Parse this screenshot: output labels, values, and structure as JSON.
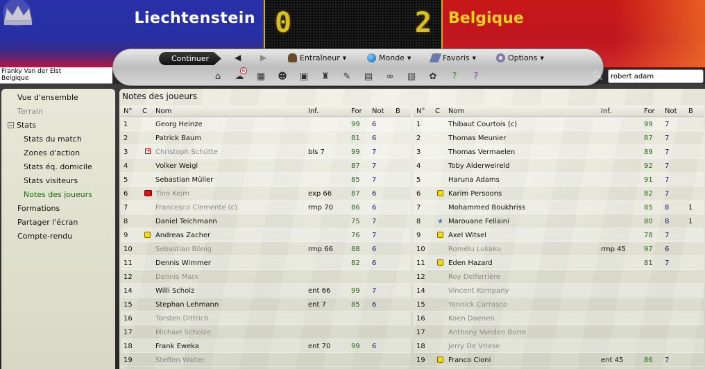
{
  "match": {
    "home_team": "Liechtenstein",
    "away_team": "Belgique",
    "home_score": "0",
    "away_score": "2"
  },
  "toolbar": {
    "continue_label": "Continuer",
    "menus": [
      "Entraîneur",
      "Monde",
      "Favoris",
      "Options"
    ],
    "notifications_badge": "6",
    "icons": [
      "home-icon",
      "inbox-icon",
      "calendar-icon",
      "squad-icon",
      "tactics-icon",
      "trophy-icon",
      "scout-icon",
      "clipboard-icon",
      "binoculars-icon",
      "report-icon",
      "club-icon",
      "help-icon",
      "question-icon"
    ]
  },
  "manager": {
    "name": "Franky Van der Elst",
    "team": "Belgique"
  },
  "search": {
    "value": "robert adam"
  },
  "sidebar": {
    "items": [
      {
        "label": "Vue d'ensemble",
        "state": "normal"
      },
      {
        "label": "Terrain",
        "state": "dim"
      },
      {
        "label": "Stats",
        "state": "group"
      },
      {
        "label": "Stats du match",
        "state": "normal"
      },
      {
        "label": "Zones d'action",
        "state": "normal"
      },
      {
        "label": "Stats éq. domicile",
        "state": "normal"
      },
      {
        "label": "Stats visiteurs",
        "state": "normal"
      },
      {
        "label": "Notes des joueurs",
        "state": "active"
      },
      {
        "label": "Formations",
        "state": "normal"
      },
      {
        "label": "Partager l'écran",
        "state": "normal"
      },
      {
        "label": "Compte-rendu",
        "state": "normal"
      }
    ]
  },
  "panel": {
    "title": "Notes des joueurs",
    "columns": {
      "num": "N°",
      "c": "C",
      "nom": "Nom",
      "inf": "Inf.",
      "for": "For",
      "not": "Not",
      "b": "B"
    }
  },
  "home_players": [
    {
      "n": "1",
      "name": "Georg Heinze",
      "inf": "",
      "for": "99",
      "not": "6",
      "b": "",
      "mark": "",
      "dim": false
    },
    {
      "n": "2",
      "name": "Patrick Baum",
      "inf": "",
      "for": "81",
      "not": "6",
      "b": "",
      "mark": "",
      "dim": false
    },
    {
      "n": "3",
      "name": "Christoph Schütte",
      "inf": "bls 7",
      "for": "99",
      "not": "7",
      "b": "",
      "mark": "injury",
      "dim": true
    },
    {
      "n": "4",
      "name": "Volker Weigl",
      "inf": "",
      "for": "87",
      "not": "7",
      "b": "",
      "mark": "",
      "dim": false
    },
    {
      "n": "5",
      "name": "Sebastian Müller",
      "inf": "",
      "for": "85",
      "not": "7",
      "b": "",
      "mark": "",
      "dim": false
    },
    {
      "n": "6",
      "name": "Tino Keim",
      "inf": "exp 66",
      "for": "87",
      "not": "6",
      "b": "",
      "mark": "red",
      "dim": true
    },
    {
      "n": "7",
      "name": "Francesco Clemente (c)",
      "inf": "rmp 70",
      "for": "86",
      "not": "6",
      "b": "",
      "mark": "",
      "dim": true
    },
    {
      "n": "8",
      "name": "Daniel Teichmann",
      "inf": "",
      "for": "75",
      "not": "7",
      "b": "",
      "mark": "",
      "dim": false
    },
    {
      "n": "9",
      "name": "Andreas Zacher",
      "inf": "",
      "for": "76",
      "not": "7",
      "b": "",
      "mark": "yellow",
      "dim": false
    },
    {
      "n": "10",
      "name": "Sebastian Bönig",
      "inf": "rmp 66",
      "for": "88",
      "not": "6",
      "b": "",
      "mark": "",
      "dim": true
    },
    {
      "n": "11",
      "name": "Dennis Wimmer",
      "inf": "",
      "for": "82",
      "not": "6",
      "b": "",
      "mark": "",
      "dim": false
    },
    {
      "n": "12",
      "name": "Dennis Marx",
      "inf": "",
      "for": "",
      "not": "",
      "b": "",
      "mark": "",
      "dim": true
    },
    {
      "n": "14",
      "name": "Willi Scholz",
      "inf": "ent 66",
      "for": "99",
      "not": "7",
      "b": "",
      "mark": "",
      "dim": false
    },
    {
      "n": "15",
      "name": "Stephan Lehmann",
      "inf": "ent 7",
      "for": "85",
      "not": "6",
      "b": "",
      "mark": "",
      "dim": false
    },
    {
      "n": "16",
      "name": "Torsten Dittrich",
      "inf": "",
      "for": "",
      "not": "",
      "b": "",
      "mark": "",
      "dim": true
    },
    {
      "n": "17",
      "name": "Michael Scholze",
      "inf": "",
      "for": "",
      "not": "",
      "b": "",
      "mark": "",
      "dim": true
    },
    {
      "n": "18",
      "name": "Frank Eweka",
      "inf": "ent 70",
      "for": "99",
      "not": "6",
      "b": "",
      "mark": "",
      "dim": false
    },
    {
      "n": "19",
      "name": "Steffen Walter",
      "inf": "",
      "for": "",
      "not": "",
      "b": "",
      "mark": "",
      "dim": true
    }
  ],
  "away_players": [
    {
      "n": "1",
      "name": "Thibaut Courtois (c)",
      "inf": "",
      "for": "99",
      "not": "7",
      "b": "",
      "mark": "",
      "dim": false
    },
    {
      "n": "2",
      "name": "Thomas Meunier",
      "inf": "",
      "for": "87",
      "not": "7",
      "b": "",
      "mark": "",
      "dim": false
    },
    {
      "n": "3",
      "name": "Thomas Vermaelen",
      "inf": "",
      "for": "89",
      "not": "7",
      "b": "",
      "mark": "",
      "dim": false
    },
    {
      "n": "4",
      "name": "Toby Alderweireld",
      "inf": "",
      "for": "92",
      "not": "7",
      "b": "",
      "mark": "",
      "dim": false
    },
    {
      "n": "5",
      "name": "Haruna Adams",
      "inf": "",
      "for": "91",
      "not": "7",
      "b": "",
      "mark": "",
      "dim": false
    },
    {
      "n": "6",
      "name": "Karim Persoons",
      "inf": "",
      "for": "82",
      "not": "7",
      "b": "",
      "mark": "yellow",
      "dim": false
    },
    {
      "n": "7",
      "name": "Mohammed Boukhriss",
      "inf": "",
      "for": "85",
      "not": "8",
      "b": "1",
      "mark": "",
      "dim": false
    },
    {
      "n": "8",
      "name": "Marouane Fellaini",
      "inf": "",
      "for": "80",
      "not": "8",
      "b": "1",
      "mark": "star",
      "dim": false
    },
    {
      "n": "9",
      "name": "Axel Witsel",
      "inf": "",
      "for": "78",
      "not": "7",
      "b": "",
      "mark": "yellow",
      "dim": false
    },
    {
      "n": "10",
      "name": "Romélu Lukaku",
      "inf": "rmp 45",
      "for": "97",
      "not": "6",
      "b": "",
      "mark": "",
      "dim": true
    },
    {
      "n": "11",
      "name": "Eden Hazard",
      "inf": "",
      "for": "81",
      "not": "7",
      "b": "",
      "mark": "yellow",
      "dim": false
    },
    {
      "n": "12",
      "name": "Roy Delferrière",
      "inf": "",
      "for": "",
      "not": "",
      "b": "",
      "mark": "",
      "dim": true
    },
    {
      "n": "14",
      "name": "Vincent Kompany",
      "inf": "",
      "for": "",
      "not": "",
      "b": "",
      "mark": "",
      "dim": true
    },
    {
      "n": "15",
      "name": "Yannick Carrasco",
      "inf": "",
      "for": "",
      "not": "",
      "b": "",
      "mark": "",
      "dim": true
    },
    {
      "n": "16",
      "name": "Koen Daenen",
      "inf": "",
      "for": "",
      "not": "",
      "b": "",
      "mark": "",
      "dim": true
    },
    {
      "n": "17",
      "name": "Anthony Vanden Borre",
      "inf": "",
      "for": "",
      "not": "",
      "b": "",
      "mark": "",
      "dim": true
    },
    {
      "n": "18",
      "name": "Jerry De Vriese",
      "inf": "",
      "for": "",
      "not": "",
      "b": "",
      "mark": "",
      "dim": true
    },
    {
      "n": "19",
      "name": "Franco Cioni",
      "inf": "ent 45",
      "for": "86",
      "not": "7",
      "b": "",
      "mark": "yellow",
      "dim": false
    }
  ]
}
